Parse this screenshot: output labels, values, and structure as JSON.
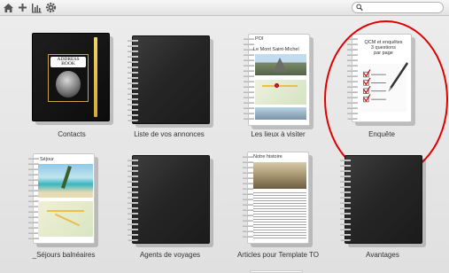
{
  "toolbar": {
    "icons": [
      "home-icon",
      "plus-icon",
      "chart-icon",
      "gear-icon"
    ],
    "search_placeholder": ""
  },
  "notebooks": [
    {
      "label": "Contacts",
      "cover": "Address Book"
    },
    {
      "label": "Liste de vos annonces"
    },
    {
      "label": "Les lieux à visiter",
      "page_title": "POI",
      "page_subtitle": "Le Mont Saint-Michel"
    },
    {
      "label": "Enquête",
      "page_title": "QCM et enquêtes",
      "page_subtitle": "3 questions",
      "page_note": "par page"
    },
    {
      "label": "_Séjours balnéaires",
      "page_title": "Séjour"
    },
    {
      "label": "Agents de voyages"
    },
    {
      "label": "Articles pour Template TO",
      "page_title": "Notre histoire"
    },
    {
      "label": "Avantages"
    }
  ],
  "colors": {
    "highlight": "#e00000",
    "background": "#e6e6e6"
  }
}
